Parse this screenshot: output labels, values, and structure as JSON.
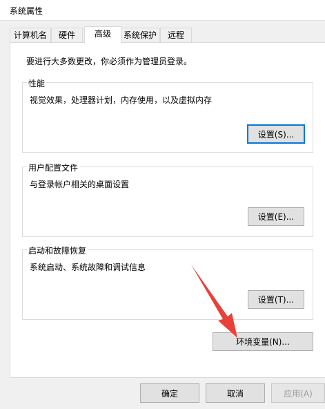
{
  "window": {
    "title": "系统属性"
  },
  "tabs": [
    {
      "label": "计算机名"
    },
    {
      "label": "硬件"
    },
    {
      "label": "高级",
      "active": true
    },
    {
      "label": "系统保护"
    },
    {
      "label": "远程"
    }
  ],
  "panel": {
    "notice": "要进行大多数更改，你必须作为管理员登录。",
    "performance": {
      "title": "性能",
      "description": "视觉效果，处理器计划，内存使用，以及虚拟内存",
      "button": "设置(S)..."
    },
    "user_profiles": {
      "title": "用户配置文件",
      "description": "与登录帐户相关的桌面设置",
      "button": "设置(E)..."
    },
    "startup_recovery": {
      "title": "启动和故障恢复",
      "description": "系统启动、系统故障和调试信息",
      "button": "设置(T)..."
    },
    "env_button": "环境变量(N)..."
  },
  "footer": {
    "ok": "确定",
    "cancel": "取消",
    "apply": "应用(A)"
  },
  "colors": {
    "focus": "#0078d7",
    "annotation_arrow": "#e8413a"
  }
}
